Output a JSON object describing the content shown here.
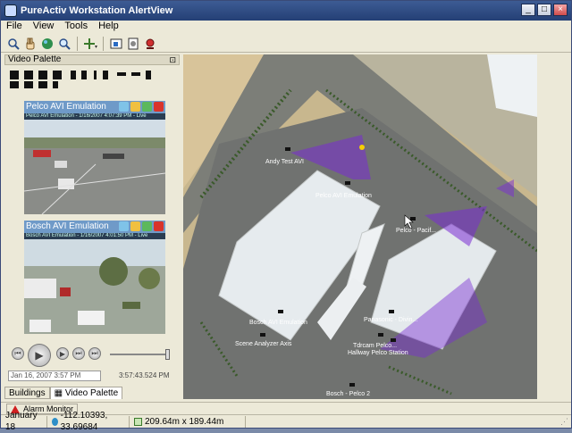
{
  "window": {
    "title": "PureActiv Workstation AlertView",
    "controls": {
      "minimize": "_",
      "maximize": "□",
      "close": "×"
    }
  },
  "menu": {
    "file": "File",
    "view": "View",
    "tools": "Tools",
    "help": "Help"
  },
  "toolbar_icons": [
    "magnify-icon",
    "hand-pan-icon",
    "globe-icon",
    "zoom-in-icon",
    "zoom-out-icon",
    "move-cross-icon",
    "select-region-icon",
    "camera-icon",
    "alarm-icon"
  ],
  "palette": {
    "title": "Video Palette",
    "pin": "⊡",
    "feeds": [
      {
        "name": "Pelco AVI Emulation",
        "sub": "Pelco AVI Emulation - 1/16/2007 4:07:39 PM - Live"
      },
      {
        "name": "Bosch AVI Emulation",
        "sub": "Bosch AVI Emulation - 1/16/2007 4:01:50 PM - Live"
      }
    ],
    "player": {
      "date": "Jan 16, 2007   3:57 PM",
      "time": "3:57:43.524 PM",
      "slider_position": 0.98
    },
    "tabs": [
      "Buildings",
      "Video Palette"
    ]
  },
  "map": {
    "labels": {
      "andy": "Andy Test AVI",
      "pelco_emul": "Pelco AVI Emulation",
      "pelco_d": "Pelco - Pacif...",
      "bosch_emul": "Bosch AVI Emulation",
      "scene": "Scene Analyzer Axis",
      "panasonic": "Panasonic - Divin...",
      "tdk": "Tdrcam Pelco...",
      "hallway": "Hallway Pelco Station",
      "bosch_pelco": "Bosch - Pelco 2"
    },
    "colors": {
      "fov": "#7a2cd4",
      "roof": "#e9eef2",
      "asphalt": "#6c6e6a"
    }
  },
  "alarm": {
    "label": "Alarm Monitor"
  },
  "status": {
    "date": "January 18",
    "coords": "-112.10393, 33.69684",
    "size": "209.64m x 189.44m"
  }
}
